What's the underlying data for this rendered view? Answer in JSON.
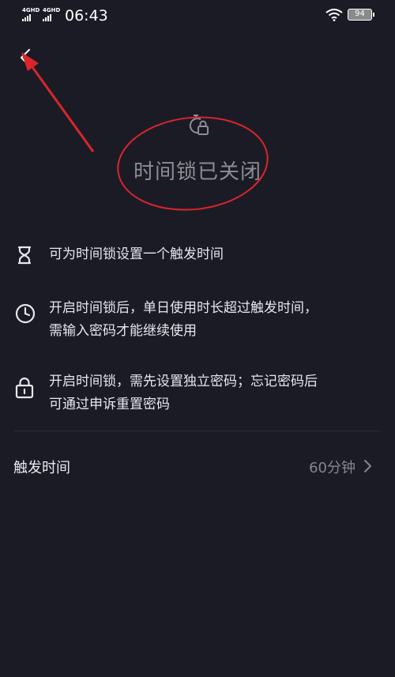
{
  "status_bar": {
    "network_1": "4GHD",
    "network_2": "4GHD",
    "time": "06:43",
    "battery": "94"
  },
  "header": {
    "title": "时间锁已关闭"
  },
  "info_items": [
    {
      "icon": "hourglass-icon",
      "text": "可为时间锁设置一个触发时间"
    },
    {
      "icon": "clock-icon",
      "line1": "开启时间锁后，单日使用时长超过触发时间，",
      "line2": "需输入密码才能继续使用"
    },
    {
      "icon": "lock-icon",
      "line1": "开启时间锁，需先设置独立密码；忘记密码后",
      "line2": "可通过申诉重置密码"
    }
  ],
  "trigger": {
    "label": "触发时间",
    "value": "60分钟"
  },
  "colors": {
    "background": "#1b1b26",
    "annotation": "#d9262a",
    "muted_text": "#8d8d94"
  }
}
